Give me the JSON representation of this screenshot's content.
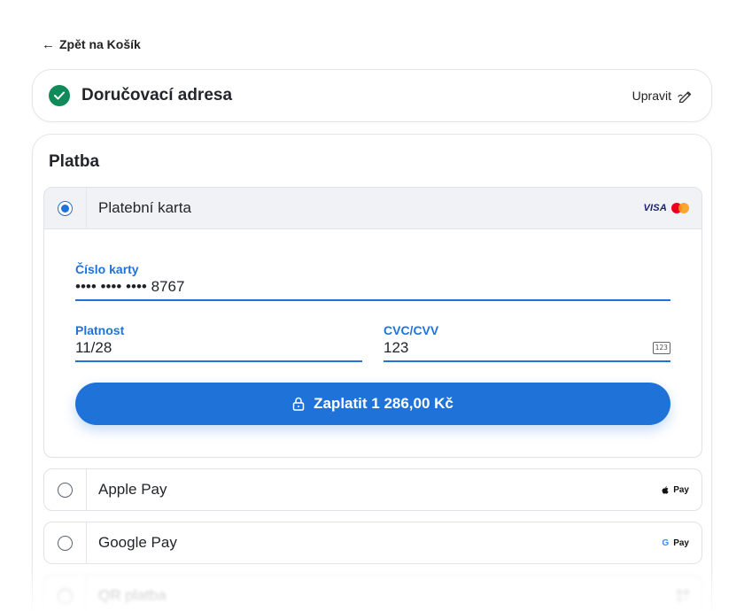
{
  "nav": {
    "back_label": "Zpět na Košík"
  },
  "address": {
    "title": "Doručovací adresa",
    "edit_label": "Upravit"
  },
  "payment": {
    "title": "Platba",
    "methods": [
      {
        "label": "Platební karta",
        "selected": true,
        "logos": [
          "visa-logo",
          "mastercard-logo"
        ],
        "visa_text": "VISA"
      },
      {
        "label": "Apple Pay",
        "selected": false,
        "logo_text": "Pay"
      },
      {
        "label": "Google Pay",
        "selected": false,
        "logo_text": "Pay",
        "logo_g": "G"
      },
      {
        "label": "QR platba",
        "selected": false,
        "logo_icon": "qr-icon"
      }
    ],
    "card_form": {
      "card_number_label": "Číslo karty",
      "card_number_value": "•••• •••• •••• 8767",
      "expiry_label": "Platnost",
      "expiry_value": "11/28",
      "cvc_label": "CVC/CVV",
      "cvc_value": "123",
      "cvc_icon_text": "123"
    },
    "pay_button_label": "Zaplatit 1 286,00 Kč"
  },
  "colors": {
    "accent": "#1f73d8",
    "success": "#118a5a",
    "border": "#dfe2e6"
  }
}
